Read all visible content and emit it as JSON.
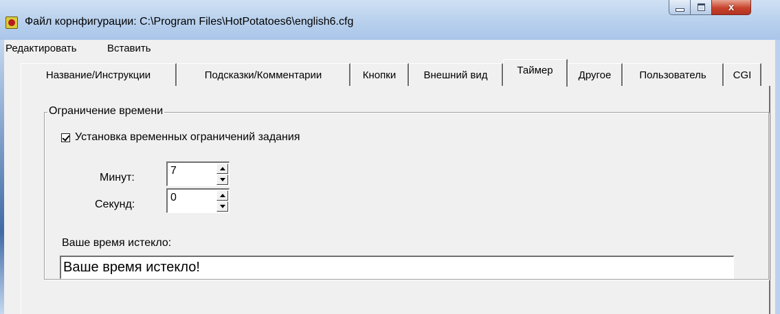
{
  "window": {
    "title": "Файл корнфигурации: C:\\Program Files\\HotPotatoes6\\english6.cfg",
    "minimize_icon": "minimize-icon",
    "maximize_icon": "maximize-icon",
    "close_glyph": "x"
  },
  "menu": {
    "items": [
      "Редактировать",
      "Вставить"
    ]
  },
  "tabs": [
    {
      "label": "Название/Инструкции",
      "active": false
    },
    {
      "label": "Подсказки/Комментарии",
      "active": false
    },
    {
      "label": "Кнопки",
      "active": false
    },
    {
      "label": "Внешний вид",
      "active": false
    },
    {
      "label": "Таймер",
      "active": true
    },
    {
      "label": "Другое",
      "active": false
    },
    {
      "label": "Пользователь",
      "active": false
    },
    {
      "label": "CGI",
      "active": false
    }
  ],
  "timer": {
    "group_title": "Ограничение времени",
    "checkbox_label": "Установка временных ограничений задания",
    "checkbox_checked": true,
    "minutes_label": "Минут:",
    "minutes_value": "7",
    "seconds_label": "Секунд:",
    "seconds_value": "0",
    "timeout_label": "Ваше время истекло:",
    "timeout_value": "Ваше время истекло!"
  },
  "colors": {
    "titlebar": "#bcd3ee",
    "close_button": "#c8432c",
    "window_background": "#f0f0f0"
  }
}
